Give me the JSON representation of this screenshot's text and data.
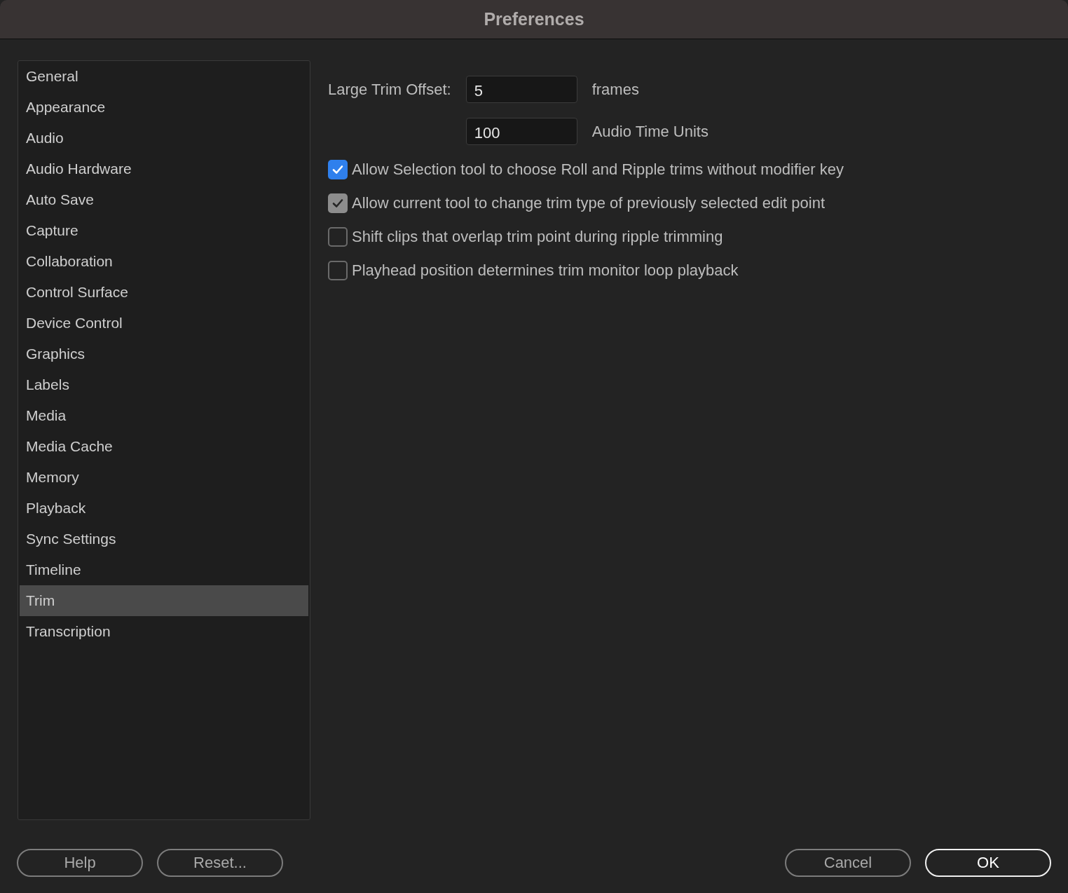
{
  "window": {
    "title": "Preferences"
  },
  "sidebar": {
    "items": [
      {
        "label": "General",
        "selected": false
      },
      {
        "label": "Appearance",
        "selected": false
      },
      {
        "label": "Audio",
        "selected": false
      },
      {
        "label": "Audio Hardware",
        "selected": false
      },
      {
        "label": "Auto Save",
        "selected": false
      },
      {
        "label": "Capture",
        "selected": false
      },
      {
        "label": "Collaboration",
        "selected": false
      },
      {
        "label": "Control Surface",
        "selected": false
      },
      {
        "label": "Device Control",
        "selected": false
      },
      {
        "label": "Graphics",
        "selected": false
      },
      {
        "label": "Labels",
        "selected": false
      },
      {
        "label": "Media",
        "selected": false
      },
      {
        "label": "Media Cache",
        "selected": false
      },
      {
        "label": "Memory",
        "selected": false
      },
      {
        "label": "Playback",
        "selected": false
      },
      {
        "label": "Sync Settings",
        "selected": false
      },
      {
        "label": "Timeline",
        "selected": false
      },
      {
        "label": "Trim",
        "selected": true
      },
      {
        "label": "Transcription",
        "selected": false
      }
    ]
  },
  "trim": {
    "fields": [
      {
        "label": "Large Trim Offset:",
        "value": "5",
        "unit": "frames"
      },
      {
        "value": "100",
        "unit": "Audio Time Units"
      }
    ],
    "options": [
      {
        "label": "Allow Selection tool to choose Roll and Ripple trims without modifier key",
        "checked": true,
        "focused": true
      },
      {
        "label": "Allow current tool to change trim type of previously selected edit point",
        "checked": true,
        "focused": false
      },
      {
        "label": "Shift clips that overlap trim point during ripple trimming",
        "checked": false,
        "focused": false
      },
      {
        "label": "Playhead position determines trim monitor loop playback",
        "checked": false,
        "focused": false
      }
    ]
  },
  "footer": {
    "left_buttons": [
      {
        "label": "Help",
        "kind": "secondary"
      },
      {
        "label": "Reset...",
        "kind": "secondary"
      }
    ],
    "right_buttons": [
      {
        "label": "Cancel",
        "kind": "secondary"
      },
      {
        "label": "OK",
        "kind": "default"
      }
    ]
  }
}
